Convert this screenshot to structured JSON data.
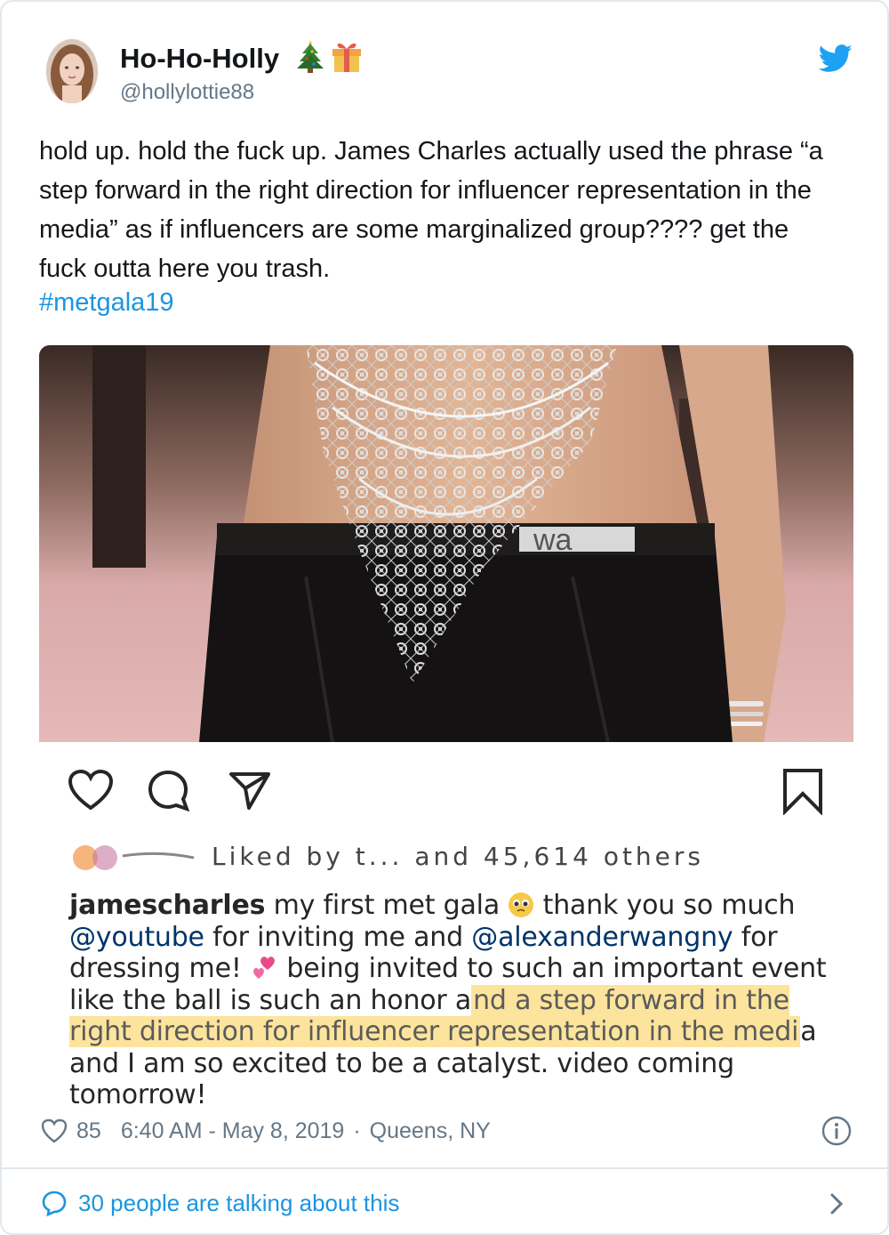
{
  "tweet": {
    "author_name": "Ho-Ho-Holly",
    "author_emojis": [
      "christmas-tree",
      "gift"
    ],
    "author_handle": "@hollylottie88",
    "text": "hold up. hold the fuck up. James Charles actually used the phrase “a step forward in the right direction for influencer representation in the media” as if influencers are some marginalized group???? get the fuck outta here you trash.",
    "hashtag": "#metgala19",
    "like_count": "85",
    "timestamp": "6:40 AM - May 8, 2019",
    "separator": "·",
    "location": "Queens, NY",
    "talking_label": "30 people are talking about this"
  },
  "embedded_post": {
    "liked_by_text": "Liked by t... and 45,614 others",
    "caption": {
      "username": "jamescharles",
      "part1": " my first met gala ",
      "part2": " thank you so much ",
      "mention1": "@youtube",
      "part3": " for inviting me and ",
      "mention2": "@alexanderwangny",
      "part4": " for dressing me! ",
      "part5": " being invited to such an important event like the ball is such an honor a",
      "highlighted": "nd a step forward in the right direction for influencer representation in the medi",
      "part6": "a and I am so excited to be a catalyst. video coming tomorrow!"
    },
    "belt_text": "wa"
  },
  "colors": {
    "link": "#1b95e0",
    "secondary_text": "#657786",
    "highlight": "#face4a",
    "twitter_bird": "#1da1f2"
  },
  "icons": [
    "heart-icon",
    "comment-icon",
    "share-icon",
    "bookmark-icon",
    "twitter-bird-icon",
    "info-icon",
    "chat-bubble-icon",
    "chevron-right-icon"
  ]
}
